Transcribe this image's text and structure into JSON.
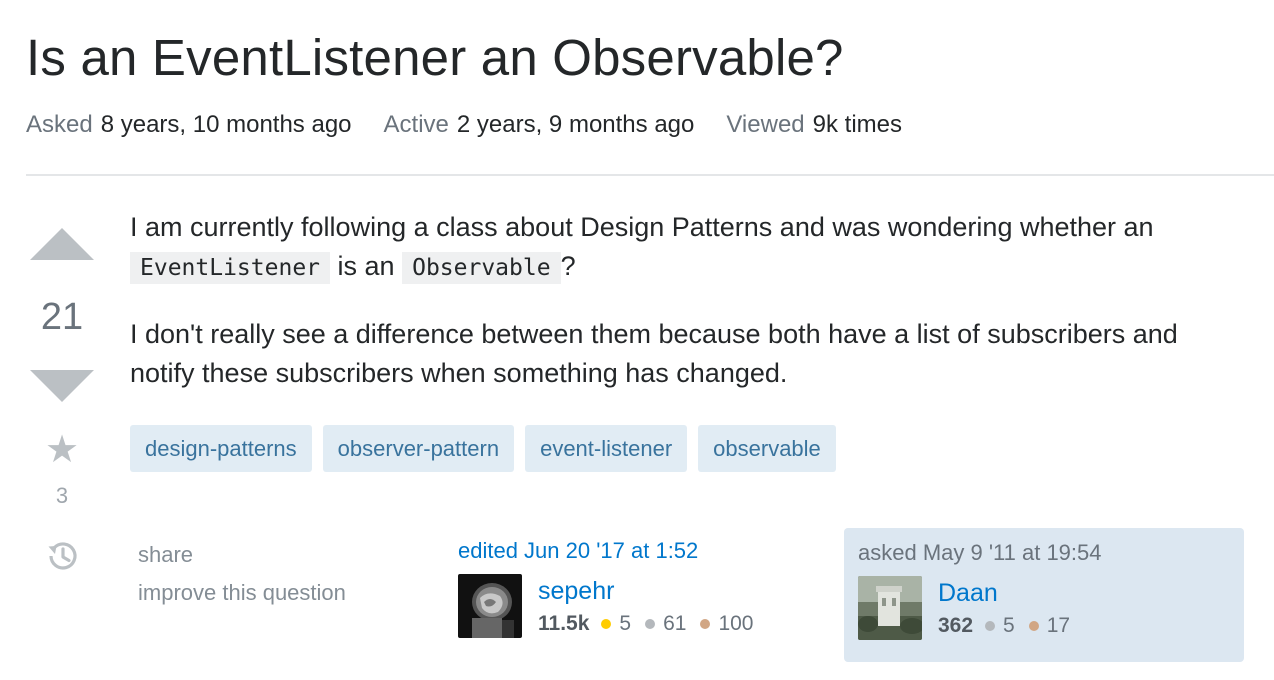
{
  "question": {
    "title": "Is an EventListener an Observable?",
    "meta": [
      {
        "label": "Asked",
        "value": "8 years, 10 months ago"
      },
      {
        "label": "Active",
        "value": "2 years, 9 months ago"
      },
      {
        "label": "Viewed",
        "value": "9k times"
      }
    ],
    "votes": "21",
    "favorites": "3",
    "body": {
      "p1_before": "I am currently following a class about Design Patterns and was wondering whether an",
      "p1_code1": "EventListener",
      "p1_middle": "is an",
      "p1_code2": "Observable",
      "p1_after": "?",
      "p2": "I don't really see a difference between them because both have a list of subscribers and notify these subscribers when something has changed."
    },
    "tags": [
      "design-patterns",
      "observer-pattern",
      "event-listener",
      "observable"
    ],
    "menu": {
      "share": "share",
      "improve": "improve this question"
    }
  },
  "edited": {
    "action": "edited Jun 20 '17 at 1:52",
    "user": {
      "name": "sepehr",
      "rep": "11.5k",
      "gold": "5",
      "silver": "61",
      "bronze": "100"
    }
  },
  "asked": {
    "action": "asked May 9 '11 at 19:54",
    "user": {
      "name": "Daan",
      "rep": "362",
      "silver": "5",
      "bronze": "17"
    }
  },
  "icons": {
    "upvote": "triangle-up-icon",
    "downvote": "triangle-down-icon",
    "favorite": "star-icon",
    "history": "history-icon"
  },
  "colors": {
    "link": "#0077cc",
    "tag_bg": "#e1ecf4",
    "tag_text": "#39739d",
    "owner_bg": "#dce7f1",
    "gold": "#ffcc01",
    "silver": "#b4b8bc",
    "bronze": "#d1a684"
  }
}
